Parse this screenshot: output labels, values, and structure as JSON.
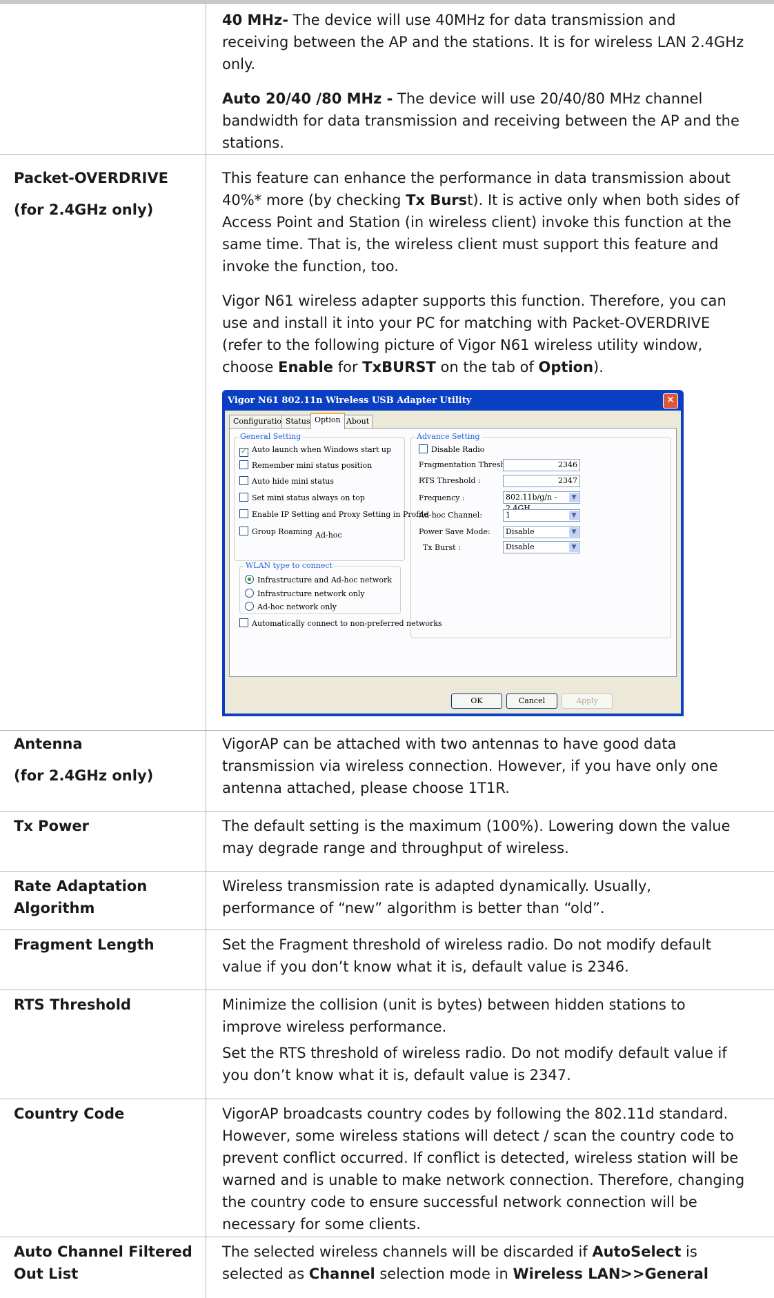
{
  "rows": [
    {
      "term_lines": [],
      "desc": [
        {
          "parts": [
            {
              "b": "40 MHz-"
            },
            {
              "t": " The device will use 40MHz for data transmission and receiving between the AP and the stations. It is for wireless LAN 2.4GHz only."
            }
          ]
        },
        {
          "parts": [
            {
              "b": "Auto 20/40 /80 MHz -"
            },
            {
              "t": " The device will use 20/40/80 MHz channel bandwidth for data transmission and receiving between the AP and the stations."
            }
          ]
        }
      ]
    },
    {
      "term_lines": [
        "Packet-OVERDRIVE",
        "(for 2.4GHz only)"
      ],
      "desc": [
        {
          "parts": [
            {
              "t": "This feature can enhance the performance in data transmission about 40%* more (by checking "
            },
            {
              "b": "Tx Burs"
            },
            {
              "t": "t). It is active only when both sides of Access Point and Station (in wireless client) invoke this function at the same time. That is, the wireless client must support this feature and invoke the function, too."
            }
          ]
        },
        {
          "parts": [
            {
              "t": "Vigor N61 wireless adapter supports this function. Therefore, you can use and install it into your PC for matching with Packet-OVERDRIVE (refer to the following picture of Vigor N61 wireless utility window, choose "
            },
            {
              "b": "Enable"
            },
            {
              "t": " for "
            },
            {
              "b": "TxBURST"
            },
            {
              "t": " on the tab of "
            },
            {
              "b": "Option"
            },
            {
              "t": ")."
            }
          ]
        }
      ]
    },
    {
      "term_lines": [
        "Antenna",
        "(for 2.4GHz only)"
      ],
      "desc": [
        {
          "parts": [
            {
              "t": "VigorAP can be attached with two antennas to have good data transmission via wireless connection. However, if you have only one antenna attached, please choose 1T1R."
            }
          ]
        }
      ]
    },
    {
      "term_lines": [
        "Tx Power"
      ],
      "desc": [
        {
          "parts": [
            {
              "t": "The default setting is the maximum (100%). Lowering down the value may degrade range and throughput of wireless."
            }
          ]
        }
      ]
    },
    {
      "term_lines": [
        "Rate Adaptation",
        "Algorithm"
      ],
      "desc": [
        {
          "parts": [
            {
              "t": "Wireless transmission rate is adapted dynamically. Usually, performance of “new” algorithm is better than “old”."
            }
          ]
        }
      ]
    },
    {
      "term_lines": [
        "Fragment Length"
      ],
      "desc": [
        {
          "parts": [
            {
              "t": "Set the Fragment threshold of wireless radio. Do not modify  default value if you don’t know what it is, default value is  2346."
            }
          ]
        }
      ]
    },
    {
      "term_lines": [
        "RTS Threshold"
      ],
      "desc": [
        {
          "parts": [
            {
              "t": "Minimize the collision (unit is bytes) between hidden stations to improve wireless performance."
            }
          ]
        },
        {
          "parts": [
            {
              "t": "Set the RTS threshold of wireless radio. Do not modify default  value if you don’t know what it is, default value is 2347."
            }
          ]
        }
      ]
    },
    {
      "term_lines": [
        "Country Code"
      ],
      "desc": [
        {
          "parts": [
            {
              "t": "VigorAP broadcasts country codes by following the 802.11d standard. However, some wireless stations will detect / scan the country code to prevent conflict occurred. If conflict is detected, wireless station will be warned and is unable to make network connection. Therefore, changing the country code to ensure successful network connection will be necessary for some clients."
            }
          ]
        }
      ]
    },
    {
      "term_lines": [
        "Auto Channel Filtered",
        "Out List"
      ],
      "desc": [
        {
          "parts": [
            {
              "t": "The selected wireless channels will be discarded if "
            },
            {
              "b": "AutoSelect"
            },
            {
              "t": " is selected as "
            },
            {
              "b": "Channel"
            },
            {
              "t": " selection mode in "
            },
            {
              "b": "Wireless LAN>>General"
            }
          ]
        }
      ]
    }
  ],
  "dialog": {
    "title": "Vigor N61 802.11n Wireless USB Adapter Utility",
    "close_glyph": "✕",
    "tabs": [
      "Configuration",
      "Status",
      "Option",
      "About"
    ],
    "general_setting": {
      "title": "General Setting",
      "items": [
        {
          "label": "Auto launch when Windows start up",
          "checked": true
        },
        {
          "label": "Remember mini status position",
          "checked": false
        },
        {
          "label": "Auto hide mini status",
          "checked": false
        },
        {
          "label": "Set mini status always on top",
          "checked": false
        },
        {
          "label": "Enable IP Setting and Proxy Setting in Profile",
          "checked": false
        },
        {
          "label": "Group Roaming",
          "checked": false
        }
      ],
      "adhoc_text": "Ad-hoc"
    },
    "wlan_type": {
      "title": "WLAN type to connect",
      "options": [
        "Infrastructure and Ad-hoc network",
        "Infrastructure network only",
        "Ad-hoc network only"
      ],
      "selected": "Infrastructure and Ad-hoc network"
    },
    "auto_connect": {
      "label": "Automatically connect to non-preferred networks",
      "checked": false
    },
    "advance_setting": {
      "title": "Advance Setting",
      "disable_radio": {
        "label": "Disable Radio",
        "checked": false
      },
      "fields": [
        {
          "label": "Fragmentation Threshold :",
          "value": "2346",
          "dropdown": false
        },
        {
          "label": "RTS Threshold :",
          "value": "2347",
          "dropdown": false
        },
        {
          "label": "Frequency :",
          "value": "802.11b/g/n - 2.4GH",
          "dropdown": true
        },
        {
          "label": "Ad-hoc Channel:",
          "value": "1",
          "dropdown": true
        },
        {
          "label": "Power Save Mode:",
          "value": "Disable",
          "dropdown": true
        },
        {
          "label": "Tx Burst :",
          "value": "Disable",
          "dropdown": true
        }
      ]
    },
    "buttons": {
      "ok": "OK",
      "cancel": "Cancel",
      "apply": "Apply"
    },
    "checkmark_glyph": "✓",
    "dropdown_glyph": "▼"
  }
}
